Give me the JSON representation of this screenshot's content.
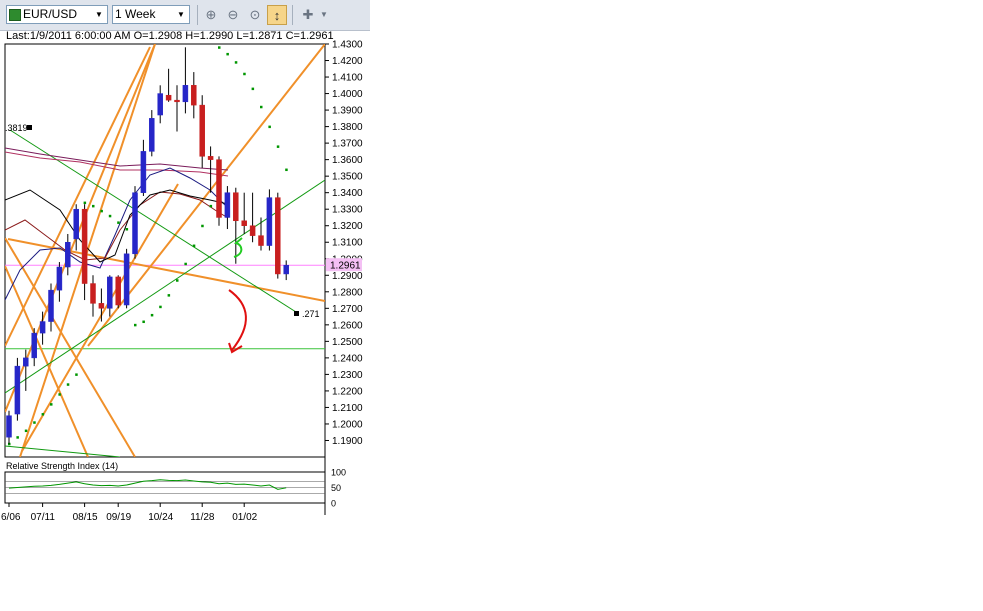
{
  "toolbar": {
    "symbol": "EUR/USD",
    "timeframe": "1 Week",
    "buttons": [
      "zoom-in-icon",
      "zoom-out-icon",
      "zoom-fit-icon",
      "vertical-scale-icon",
      "crosshair-icon"
    ]
  },
  "info": {
    "text": "Last:1/9/2011 6:00:00 AM O=1.2908 H=1.2990 L=1.2871 C=1.2961"
  },
  "chart_data": [
    {
      "type": "candlestick",
      "title": "",
      "ylim": [
        1.18,
        1.43
      ],
      "yticks": [
        "1.4300",
        "1.4200",
        "1.4100",
        "1.4000",
        "1.3900",
        "1.3800",
        "1.3700",
        "1.3600",
        "1.3500",
        "1.3400",
        "1.3300",
        "1.3200",
        "1.3100",
        "1.3000",
        "1.2900",
        "1.2800",
        "1.2700",
        "1.2600",
        "1.2500",
        "1.2400",
        "1.2300",
        "1.2200",
        "1.2100",
        "1.2000",
        "1.1900"
      ],
      "xticks": [
        "6/06",
        "07/11",
        "08/15",
        "09/19",
        "10/24",
        "11/28",
        "01/02"
      ],
      "last_price_label": "1.2961",
      "last_price": 1.2961,
      "annotations": [
        ".3819",
        ".271"
      ],
      "horizontal_line": 1.2455,
      "candles": [
        {
          "o": 1.192,
          "h": 1.208,
          "l": 1.188,
          "c": 1.205
        },
        {
          "o": 1.206,
          "h": 1.24,
          "l": 1.202,
          "c": 1.235
        },
        {
          "o": 1.235,
          "h": 1.245,
          "l": 1.22,
          "c": 1.24
        },
        {
          "o": 1.24,
          "h": 1.258,
          "l": 1.235,
          "c": 1.255
        },
        {
          "o": 1.255,
          "h": 1.268,
          "l": 1.248,
          "c": 1.262
        },
        {
          "o": 1.262,
          "h": 1.285,
          "l": 1.256,
          "c": 1.281
        },
        {
          "o": 1.281,
          "h": 1.298,
          "l": 1.274,
          "c": 1.295
        },
        {
          "o": 1.295,
          "h": 1.315,
          "l": 1.29,
          "c": 1.31
        },
        {
          "o": 1.312,
          "h": 1.333,
          "l": 1.305,
          "c": 1.33
        },
        {
          "o": 1.33,
          "h": 1.333,
          "l": 1.275,
          "c": 1.285
        },
        {
          "o": 1.285,
          "h": 1.29,
          "l": 1.265,
          "c": 1.273
        },
        {
          "o": 1.273,
          "h": 1.282,
          "l": 1.262,
          "c": 1.27
        },
        {
          "o": 1.27,
          "h": 1.29,
          "l": 1.265,
          "c": 1.289
        },
        {
          "o": 1.289,
          "h": 1.29,
          "l": 1.27,
          "c": 1.272
        },
        {
          "o": 1.272,
          "h": 1.306,
          "l": 1.27,
          "c": 1.303
        },
        {
          "o": 1.303,
          "h": 1.344,
          "l": 1.3,
          "c": 1.34
        },
        {
          "o": 1.34,
          "h": 1.372,
          "l": 1.338,
          "c": 1.365
        },
        {
          "o": 1.365,
          "h": 1.39,
          "l": 1.362,
          "c": 1.385
        },
        {
          "o": 1.387,
          "h": 1.405,
          "l": 1.382,
          "c": 1.4
        },
        {
          "o": 1.399,
          "h": 1.415,
          "l": 1.395,
          "c": 1.396
        },
        {
          "o": 1.396,
          "h": 1.405,
          "l": 1.377,
          "c": 1.395
        },
        {
          "o": 1.395,
          "h": 1.428,
          "l": 1.388,
          "c": 1.405
        },
        {
          "o": 1.405,
          "h": 1.413,
          "l": 1.385,
          "c": 1.393
        },
        {
          "o": 1.393,
          "h": 1.399,
          "l": 1.355,
          "c": 1.362
        },
        {
          "o": 1.362,
          "h": 1.368,
          "l": 1.34,
          "c": 1.36
        },
        {
          "o": 1.36,
          "h": 1.362,
          "l": 1.32,
          "c": 1.325
        },
        {
          "o": 1.325,
          "h": 1.344,
          "l": 1.318,
          "c": 1.34
        },
        {
          "o": 1.34,
          "h": 1.343,
          "l": 1.297,
          "c": 1.323
        },
        {
          "o": 1.323,
          "h": 1.34,
          "l": 1.315,
          "c": 1.32
        },
        {
          "o": 1.32,
          "h": 1.34,
          "l": 1.31,
          "c": 1.314
        },
        {
          "o": 1.314,
          "h": 1.325,
          "l": 1.305,
          "c": 1.308
        },
        {
          "o": 1.308,
          "h": 1.342,
          "l": 1.305,
          "c": 1.337
        },
        {
          "o": 1.337,
          "h": 1.34,
          "l": 1.288,
          "c": 1.2908
        },
        {
          "o": 1.2908,
          "h": 1.299,
          "l": 1.2871,
          "c": 1.2961
        }
      ],
      "psar": [
        1.188,
        1.192,
        1.196,
        1.201,
        1.206,
        1.212,
        1.218,
        1.224,
        1.23,
        1.334,
        1.332,
        1.329,
        1.326,
        1.322,
        1.318,
        1.26,
        1.262,
        1.266,
        1.271,
        1.278,
        1.287,
        1.297,
        1.308,
        1.32,
        1.332,
        1.428,
        1.424,
        1.419,
        1.412,
        1.403,
        1.392,
        1.38,
        1.368,
        1.354
      ]
    },
    {
      "type": "line",
      "title": "Relative Strength Index (14)",
      "ylim": [
        0,
        100
      ],
      "yticks": [
        "100",
        "50",
        "0"
      ],
      "values": [
        48,
        50,
        52,
        54,
        55,
        57,
        60,
        64,
        68,
        62,
        58,
        56,
        57,
        55,
        58,
        64,
        70,
        72,
        75,
        73,
        72,
        74,
        71,
        68,
        67,
        62,
        64,
        60,
        61,
        58,
        55,
        58,
        44,
        49
      ]
    }
  ],
  "colors": {
    "bull": "#2626c8",
    "bear": "#c81f1f",
    "psar": "#009600",
    "orange": "#f0902a",
    "green_line": "#129a12",
    "price_line": "#ff80ff",
    "arrow_red": "#e01010",
    "arrow_green": "#22cc22"
  }
}
